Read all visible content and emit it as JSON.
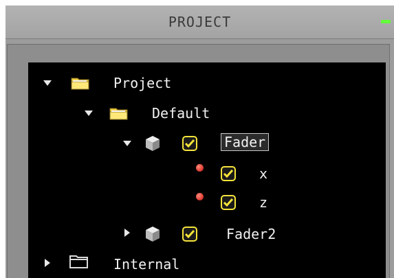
{
  "window": {
    "title": "PROJECT"
  },
  "colors": {
    "minimize_button": "#63ff3a",
    "folder_yellow": "#ffe46a",
    "check_yellow": "#f5e43a",
    "status_dot_red": "#d8342a",
    "tree_background": "#000000"
  },
  "tree": {
    "items": [
      {
        "label": "Project",
        "type": "folder",
        "expanded": true,
        "icon": "folder-open-icon"
      },
      {
        "label": "Default",
        "type": "folder",
        "expanded": true,
        "icon": "folder-open-icon"
      },
      {
        "label": "Fader",
        "type": "object",
        "expanded": true,
        "checked": true,
        "selected": true,
        "icon": "cube-icon"
      },
      {
        "label": "x",
        "type": "parameter",
        "checked": true,
        "icon": "red-dot-icon"
      },
      {
        "label": "z",
        "type": "parameter",
        "checked": true,
        "icon": "red-dot-icon"
      },
      {
        "label": "Fader2",
        "type": "object",
        "expanded": false,
        "checked": true,
        "icon": "cube-icon"
      },
      {
        "label": "Internal",
        "type": "folder",
        "expanded": false,
        "icon": "folder-closed-icon"
      }
    ]
  }
}
